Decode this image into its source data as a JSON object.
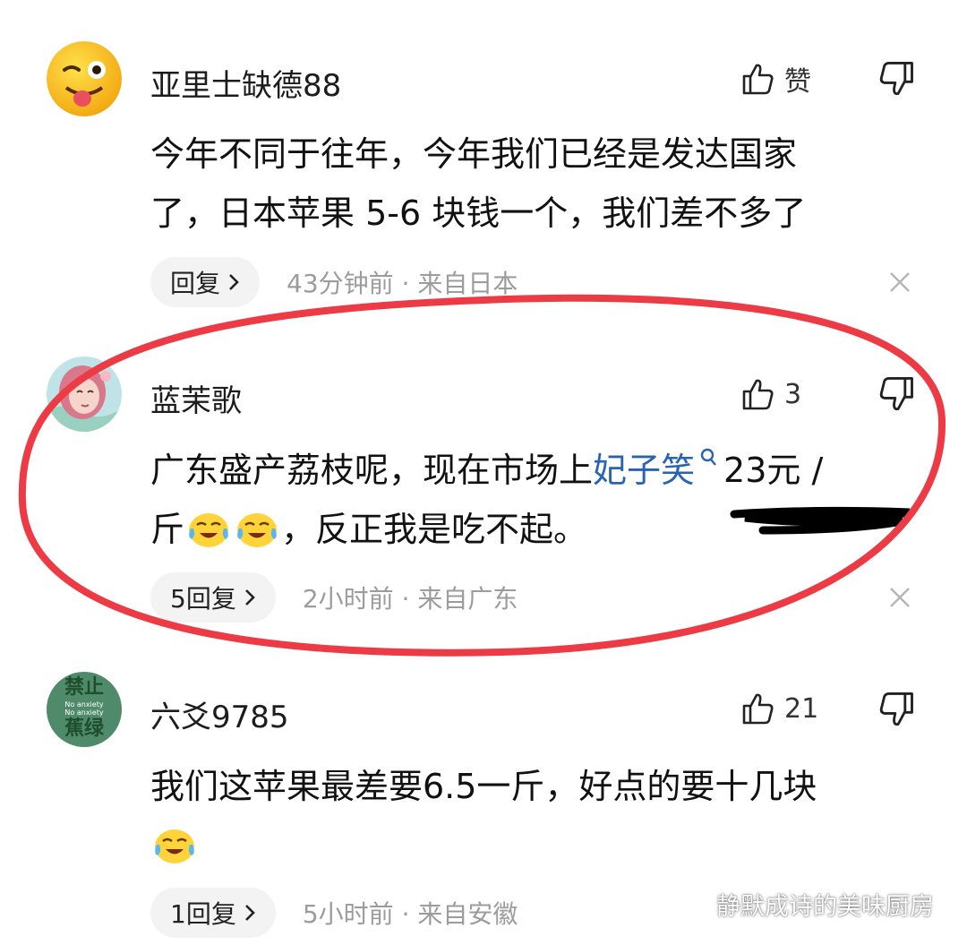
{
  "comments": [
    {
      "username": "亚里士缺德88",
      "like_label": "赞",
      "text_line1": "今年不同于往年，今年我们已经是发达国家",
      "text_line2": "了，日本苹果 5-6 块钱一个，我们差不多了",
      "reply_label": "回复",
      "meta": "43分钟前 · 来自日本"
    },
    {
      "username": "蓝茉歌",
      "like_count": "3",
      "text_before_link": "广东盛产荔枝呢，现在市场上",
      "link_text": "妃子笑",
      "text_after_link": "23元 /",
      "text_line2_a": "斤",
      "text_line2_b": "，反正我是吃不起。",
      "reply_label": "5回复",
      "meta": "2小时前 · 来自广东"
    },
    {
      "username": "六爻9785",
      "avatar_text_top": "禁止",
      "avatar_text_mid1": "No anxiety",
      "avatar_text_mid2": "No anxiety",
      "avatar_text_bottom": "蕉绿",
      "like_count": "21",
      "text_line1": "我们这苹果最差要6.5一斤，好点的要十几块",
      "reply_label": "1回复",
      "meta": "5小时前 · 来自安徽"
    }
  ],
  "watermark": "静默成诗的美味厨房",
  "colors": {
    "highlight_ring": "#ec3b45",
    "link": "#2a64b0",
    "meta_gray": "#9c9c9c",
    "reply_bg": "#f3f3f3"
  }
}
